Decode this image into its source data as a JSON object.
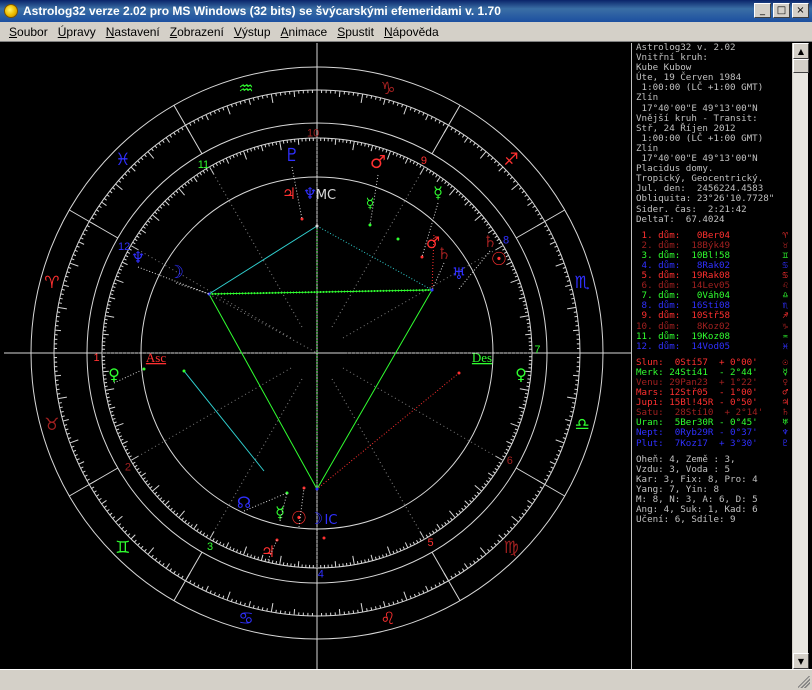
{
  "window": {
    "title": "Astrolog32 verze 2.02 pro MS Windows (32 bits) se švýcarskými efemeridami v. 1.70",
    "buttons": {
      "minimize": "_",
      "maximize": "□",
      "close": "×"
    }
  },
  "menu": [
    "Soubor",
    "Úpravy",
    "Nastavení",
    "Zobrazení",
    "Výstup",
    "Animace",
    "Spustit",
    "Nápověda"
  ],
  "info": {
    "header": [
      "Astrolog32 v. 2.02",
      "Vnitřní kruh:",
      "Kube Kubow",
      "Úte, 19 Červen 1984",
      " 1:00:00 (LČ +1:00 GMT)",
      "Zlín",
      " 17°40'00\"E 49°13'00\"N",
      "Vnější kruh - Transit:",
      "Stř, 24 Říjen 2012",
      " 1:00:00 (LČ +1:00 GMT)",
      "Zlín",
      " 17°40'00\"E 49°13'00\"N",
      "Placidus domy.",
      "Tropický, Geocentrický.",
      "Jul. den:  2456224.4583",
      "Obliquita: 23°26'10.7728\"",
      "Sider. čas:  2:21:42",
      "DeltaT:  67.4024"
    ],
    "houses": [
      {
        "text": " 1. dům:   0Ber04",
        "glyph": "♈",
        "color": "#ff3030"
      },
      {
        "text": " 2. dům:  18Býk49",
        "glyph": "♉",
        "color": "#a02020"
      },
      {
        "text": " 3. dům:  10Bl!58",
        "glyph": "♊",
        "color": "#30ff30"
      },
      {
        "text": " 4. dům:   8Rak02",
        "glyph": "♋",
        "color": "#3030ff"
      },
      {
        "text": " 5. dům:  19Rak08",
        "glyph": "♋",
        "color": "#ff3030"
      },
      {
        "text": " 6. dům:  14Lev05",
        "glyph": "♌",
        "color": "#a02020"
      },
      {
        "text": " 7. dům:   0Váh04",
        "glyph": "♎",
        "color": "#30ff30"
      },
      {
        "text": " 8. dům:  16Stí08",
        "glyph": "♏",
        "color": "#3030ff"
      },
      {
        "text": " 9. dům:  10Stř58",
        "glyph": "♐",
        "color": "#ff3030"
      },
      {
        "text": "10. dům:   8Koz02",
        "glyph": "♑",
        "color": "#a02020"
      },
      {
        "text": "11. dům:  19Koz08",
        "glyph": "♒",
        "color": "#30ff30"
      },
      {
        "text": "12. dům:  14Vod05",
        "glyph": "♓",
        "color": "#3030ff"
      }
    ],
    "planets": [
      {
        "text": "Slun:  0Stí57  + 0°00'",
        "glyph": "☉",
        "color": "#ff3030"
      },
      {
        "text": "Merk: 24Stí41  - 2°44'",
        "glyph": "☿",
        "color": "#30ff30"
      },
      {
        "text": "Venu: 29Pan23  + 1°22'",
        "glyph": "♀",
        "color": "#a02020"
      },
      {
        "text": "Mars: 12Stř05  - 1°00'",
        "glyph": "♂",
        "color": "#ff3030"
      },
      {
        "text": "Jupi: 15Bl!45R - 0°50'",
        "glyph": "♃",
        "color": "#ff3030"
      },
      {
        "text": "Satu:  28Stí10  + 2°14'",
        "glyph": "♄",
        "color": "#a02020"
      },
      {
        "text": "Uran:  5Ber30R - 0°45'",
        "glyph": "♅",
        "color": "#30ff30"
      },
      {
        "text": "Nept:  0Ryb29R - 0°37'",
        "glyph": "♆",
        "color": "#3030ff"
      },
      {
        "text": "Plut:  7Koz17  + 3°30'",
        "glyph": "♇",
        "color": "#3030ff"
      }
    ],
    "elements": [
      "Oheň: 4, Země : 3,",
      "Vzdu: 3, Voda : 5",
      "Kar: 3, Fix: 8, Pro: 4",
      "Yang: 7, Yin: 8",
      "M: 8, N: 3, A: 6, D: 5",
      "Ang: 4, Suk: 1, Kad: 6",
      "Učení: 6, Sdíle: 9"
    ]
  },
  "chart": {
    "sign_glyphs": [
      "♈",
      "♉",
      "♊",
      "♋",
      "♌",
      "♍",
      "♎",
      "♏",
      "♐",
      "♑",
      "♒",
      "♓"
    ],
    "sign_colors": [
      "#ff3030",
      "#a02020",
      "#30ff30",
      "#3030ff",
      "#ff3030",
      "#a02020",
      "#30ff30",
      "#3030ff",
      "#ff3030",
      "#a02020",
      "#30ff30",
      "#3030ff"
    ],
    "house_numbers": [
      "1",
      "2",
      "3",
      "4",
      "5",
      "6",
      "7",
      "8",
      "9",
      "10",
      "11",
      "12"
    ],
    "house_colors": [
      "#ff3030",
      "#a02020",
      "#30ff30",
      "#3030ff",
      "#ff3030",
      "#a02020",
      "#30ff30",
      "#3030ff",
      "#ff3030",
      "#a02020",
      "#30ff30",
      "#3030ff"
    ],
    "asc_label": "Asc",
    "des_label": "Des",
    "planet_glyphs": {
      "sun": "☉",
      "moon": "☽",
      "mercury": "☿",
      "venus": "♀",
      "mars": "♂",
      "jupiter": "♃",
      "saturn": "♄",
      "uranus": "♅",
      "neptune": "♆",
      "pluto": "♇",
      "node": "☊",
      "mc": "MC",
      "ic": "IC"
    }
  }
}
